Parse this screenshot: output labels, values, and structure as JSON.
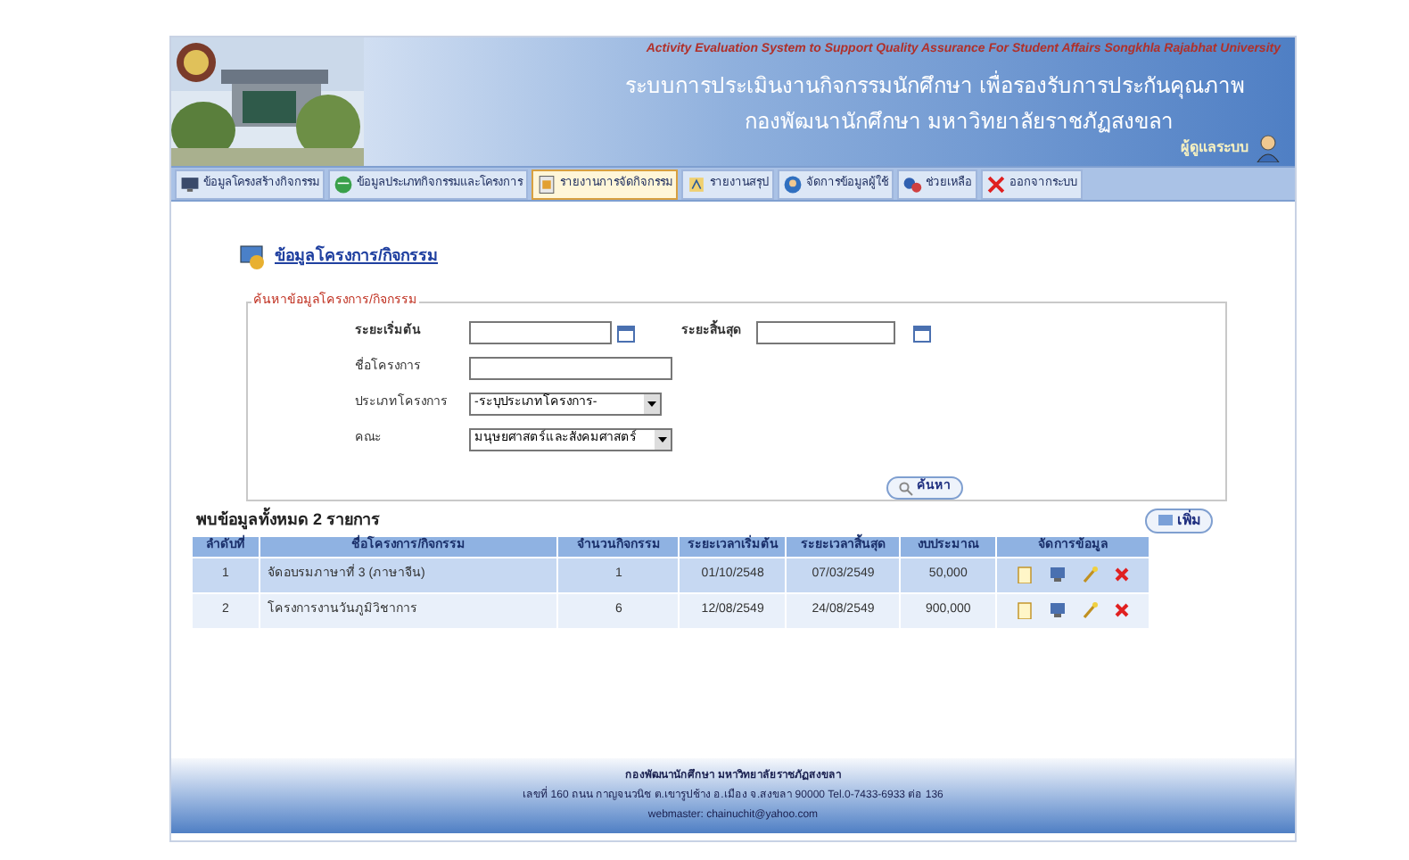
{
  "header": {
    "subtitle_en": "Activity Evaluation System to Support Quality Assurance For Student Affairs Songkhla Rajabhat University",
    "title": "ระบบการประเมินงานกิจกรรมนักศึกษา  เพื่อรองรับการประกันคุณภาพ",
    "organization": "กองพัฒนานักศึกษา  มหาวิทยาลัยราชภัฏสงขลา",
    "user_role": "ผู้ดูแลระบบ"
  },
  "menu": [
    {
      "label": "ข้อมูลโครงสร้างกิจกรรม",
      "selected": false
    },
    {
      "label": "ข้อมูลประเภทกิจกรรมและโครงการ",
      "selected": false
    },
    {
      "label": "รายงานการจัดกิจกรรม",
      "selected": true
    },
    {
      "label": "รายงานสรุป",
      "selected": false
    },
    {
      "label": "จัดการข้อมูลผู้ใช้",
      "selected": false
    },
    {
      "label": "ช่วยเหลือ",
      "selected": false
    },
    {
      "label": "ออกจากระบบ",
      "selected": false
    }
  ],
  "page_title": "ข้อมูลโครงการ/กิจกรรม",
  "search": {
    "legend": "ค้นหาข้อมูลโครงการ/กิจกรรม",
    "start_label": "ระยะเริ่มต้น",
    "end_label": "ระยะสิ้นสุด",
    "name_label": "ชื่อโครงการ",
    "type_label": "ประเภทโครงการ",
    "type_value": "-ระบุประเภทโครงการ-",
    "faculty_label": "คณะ",
    "faculty_value": "มนุษยศาสตร์และสังคมศาสตร์",
    "button": "ค้นหา"
  },
  "result_count": "พบข้อมูลทั้งหมด 2 รายการ",
  "add_button": "เพิ่ม",
  "table": {
    "columns": [
      "ลำดับที่",
      "ชื่อโครงการ/กิจกรรม",
      "จำนวนกิจกรรม",
      "ระยะเวลาเริ่มต้น",
      "ระยะเวลาสิ้นสุด",
      "งบประมาณ",
      "จัดการข้อมูล"
    ],
    "rows": [
      {
        "cells": [
          "1",
          "จัดอบรมภาษาที่ 3 (ภาษาจีน)",
          "1",
          "01/10/2548",
          "07/03/2549",
          "50,000"
        ],
        "selected": true
      },
      {
        "cells": [
          "2",
          "โครงการงานวันภูมิวิชาการ",
          "6",
          "12/08/2549",
          "24/08/2549",
          "900,000"
        ],
        "selected": false
      }
    ]
  },
  "footer": {
    "lines": [
      "กองพัฒนานักศึกษา มหาวิทยาลัยราชภัฏสงขลา",
      "เลขที่ 160 ถนน กาญจนวนิช ต.เขารูปช้าง อ.เมือง จ.สงขลา 90000 Tel.0-7433-6933 ต่อ 136",
      "webmaster: chainuchit@yahoo.com"
    ]
  }
}
